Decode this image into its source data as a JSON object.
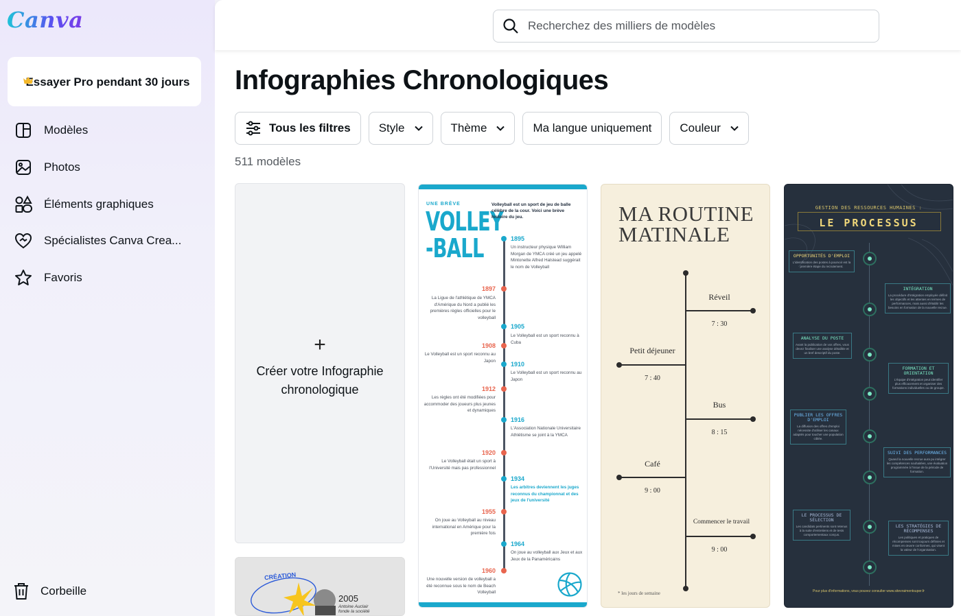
{
  "sidebar": {
    "logo": "Canva",
    "pro_card": "Essayer Pro pendant 30 jours",
    "items": [
      {
        "label": "Modèles",
        "icon": "templates-icon"
      },
      {
        "label": "Photos",
        "icon": "photo-icon"
      },
      {
        "label": "Éléments graphiques",
        "icon": "shapes-icon"
      },
      {
        "label": "Spécialistes Canva Crea...",
        "icon": "heart-icon"
      },
      {
        "label": "Favoris",
        "icon": "star-icon"
      }
    ],
    "trash": "Corbeille"
  },
  "search": {
    "placeholder": "Recherchez des milliers de modèles"
  },
  "page_title": "Infographies Chronologiques",
  "filters": {
    "all": "Tous les filtres",
    "style": "Style",
    "theme": "Thème",
    "language": "Ma langue uniquement",
    "color": "Couleur"
  },
  "count": "511 modèles",
  "create_card": {
    "plus": "+",
    "label": "Créer votre Infographie chronologique"
  },
  "thumb2": {
    "tag": "CRÉATION",
    "year": "2005",
    "caption": "Antoine Auclair fonde la société"
  },
  "volley": {
    "breve": "UNE BRÈVE",
    "big": "VOLLEY\n-BALL",
    "intro": "Volleyball est un sport de jeu de balle célèbre de la cour. Voici une brève histoire du jeu.",
    "events": [
      {
        "year": "1895",
        "text": "Un instructeur physique William Morgan de YMCA créé un jeu appelé Mintonette Alfred Halstead suggérait le nom de Volleyball"
      },
      {
        "year": "1897",
        "text": "La Ligue de l'athlétique de YMCA d'Amérique du Nord a publié les premières règles officielles pour le volleyball"
      },
      {
        "year": "1905",
        "text": "Le Volleyball est un sport reconnu à Cuba"
      },
      {
        "year": "1908",
        "text": "Le Volleyball est un sport reconnu au Japon"
      },
      {
        "year": "1910",
        "text": "Le Volleyball est un sport reconnu au Japon"
      },
      {
        "year": "1912",
        "text": "Les règles ont été modifiées pour accommoder des joueurs plus jeunes et dynamiques"
      },
      {
        "year": "1916",
        "text": "L'Association Nationale Universitaire Athlétisme se joint à la YMCA"
      },
      {
        "year": "1920",
        "text": "Le Volleyball était un sport à l'Université mais pas professionnel"
      },
      {
        "year": "1934",
        "text": "Les arbitres deviennent les juges reconnus du championnat et des jeux de l'université"
      },
      {
        "year": "1955",
        "text": "On joue au Volleyball au niveau international en Amérique pour la première fois"
      },
      {
        "year": "1964",
        "text": "On joue au volleyball aux Jeux et aux Jeux de la Panaméricains"
      },
      {
        "year": "1960",
        "text": "Une nouvelle version de volleyball a été reconnue sous le nom de Beach Volleyball"
      }
    ]
  },
  "routine": {
    "title": "MA ROUTINE\nMATINALE",
    "items": [
      {
        "label": "Réveil",
        "time": "7 : 30"
      },
      {
        "label": "Petit déjeuner",
        "time": "7 : 40"
      },
      {
        "label": "Bus",
        "time": "8 : 15"
      },
      {
        "label": "Café",
        "time": "9 : 00"
      },
      {
        "label": "Commencer le travail",
        "time": "9 : 00"
      }
    ],
    "note": "* les jours de semaine"
  },
  "process": {
    "subtitle": "GESTION DES RESSOURCES HUMAINES :",
    "title": "LE PROCESSUS",
    "steps": [
      {
        "title": "OPPORTUNITÉS D'EMPLOI",
        "text": "L'identification des postes à pourvoir est la première étape du recrutement.",
        "color": "#f0d77a"
      },
      {
        "title": "INTÉGRATION",
        "text": "La procédure d'intégration employée définit les objectifs et les attentes en termes de performances, mais aussi d'établir les besoins en formation de la nouvelle recrue.",
        "color": "#7be8c4"
      },
      {
        "title": "ANALYSE DU POSTE",
        "text": "Avant la publication de vos offres, vous devez finaliser une analyse détaillée et un bref descriptif du poste.",
        "color": "#7be8c4"
      },
      {
        "title": "FORMATION ET ORIENTATION",
        "text": "L'équipe d'intégration peut identifier plus efficacement et organiser des formations individuelles ou de groupe.",
        "color": "#7be8c4"
      },
      {
        "title": "PUBLIER LES OFFRES D'EMPLOI",
        "text": "La diffusion des offres d'emploi nécessite d'utiliser les canaux adaptés pour toucher une population ciblée.",
        "color": "#6fb8f0"
      },
      {
        "title": "SUIVI DES PERFORMANCES",
        "text": "Quand la nouvelle recrue aura pu intégrer les compétences souhaitées, une évaluation programmée à l'issue de la période de formation.",
        "color": "#6fb8f0"
      },
      {
        "title": "LE PROCESSUS DE SÉLECTION",
        "text": "Les candidats pertinents sont retenus à la suite d'entretiens et de tests comportementaux conçus.",
        "color": "#a7b8d6"
      },
      {
        "title": "LES STRATÉGIES DE RÉCOMPENSES",
        "text": "Les politiques et pratiques de récompenses sont toujours définies et mises en œuvre conformes, qui visent la valeur de l'organisation.",
        "color": "#a7b8d6"
      }
    ],
    "footer": "Pour plus d'informations, vous pouvez consulter www.sitevraimentsuper.fr"
  }
}
